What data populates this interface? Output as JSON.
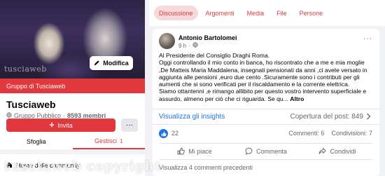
{
  "group": {
    "cover_watermark": "tusciaweb",
    "edit_label": "Modifica",
    "banner": "Gruppo di Tusciaweb",
    "name": "Tusciaweb",
    "privacy": "Gruppo Pubblico",
    "members": "8593 membri",
    "invite_label": "Invita",
    "more_label": "···",
    "tabs": [
      {
        "label": "Sfoglia"
      },
      {
        "label": "Gestisci",
        "badge": "1"
      }
    ],
    "home_item": "Home della community"
  },
  "topnav": {
    "tabs": [
      {
        "label": "Discussione"
      },
      {
        "label": "Argomenti"
      },
      {
        "label": "Media"
      },
      {
        "label": "File"
      },
      {
        "label": "Persone"
      }
    ]
  },
  "post": {
    "author": "Antonio Bartolomei",
    "time": "9 h",
    "body_lines": [
      "Al Presidente del Consiglio Draghi Roma.",
      "Oggi controllando il mio conto in banca, ho riscontrato che a me e mia moglie",
      ",De Matteis Maria Maddalena, insegnati pensionati da anni ,ci avete versato in",
      "aggiunta alle pensioni ,euro due cento .Sicuramente sono i contributi per gli",
      "aumenti che si sono verificati per il riscaldamento e la corrente elettrica.",
      "Siamo ottantenni ,e rimango allibito per questo vostro intervento superficiale e",
      "assurdo, almeno per ciò che ci riguarda. Se qu..."
    ],
    "more_link": "Altro",
    "insights_label": "Visualizza gli insights",
    "coverage": "Copertura del post: 849",
    "likes": "22",
    "comments": "Commenti: 6",
    "shares": "Condivisioni: 7",
    "actions": {
      "like": "Mi piace",
      "comment": "Commenta",
      "share": "Condividi"
    },
    "prev_comments": "Visualizza 4 commenti precedenti"
  },
  "watermark": "tusciaweb copyright",
  "colors": {
    "accent": "#e0383d",
    "link": "#1b74e4",
    "muted": "#65676b",
    "background": "#f0f2f5"
  },
  "icons": [
    "pencil-icon",
    "globe-icon",
    "plus-icon",
    "home-icon",
    "globe-icon",
    "chevron-right-icon",
    "like-badge-icon",
    "thumb-up-icon",
    "comment-icon",
    "share-icon"
  ]
}
